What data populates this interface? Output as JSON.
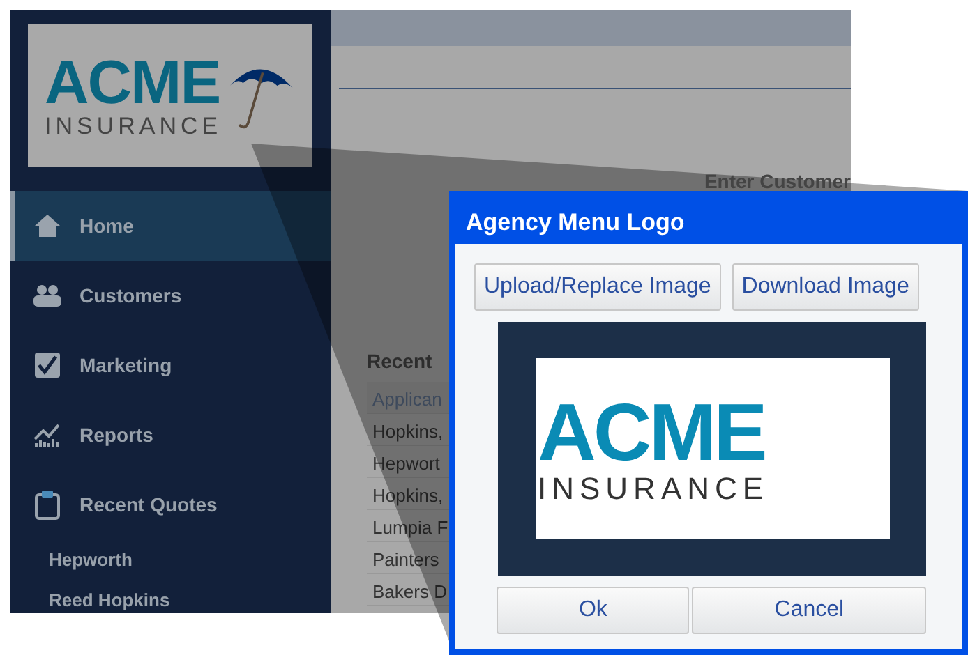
{
  "sidebar": {
    "logo": {
      "brand": "ACME",
      "tagline": "INSURANCE"
    },
    "items": [
      {
        "label": "Home",
        "kind": "home",
        "selected": true
      },
      {
        "label": "Customers",
        "kind": "people",
        "selected": false
      },
      {
        "label": "Marketing",
        "kind": "check",
        "selected": false
      },
      {
        "label": "Reports",
        "kind": "chart",
        "selected": false
      },
      {
        "label": "Recent Quotes",
        "kind": "clipboard",
        "selected": false
      }
    ],
    "recent": [
      "Hepworth",
      "Reed Hopkins"
    ]
  },
  "main": {
    "prompt": "Enter Customer",
    "recent_heading": "Recent",
    "table": {
      "header": "Applican",
      "rows": [
        "Hopkins,",
        "Hepwort",
        "Hopkins,",
        "Lumpia F",
        "Painters",
        "Bakers D"
      ]
    }
  },
  "dialog": {
    "title": "Agency Menu Logo",
    "actions": [
      "Upload/Replace Image",
      "Download Image"
    ],
    "preview": {
      "brand": "ACME",
      "tagline": "INSURANCE"
    },
    "buttons": [
      "Ok",
      "Cancel"
    ]
  }
}
